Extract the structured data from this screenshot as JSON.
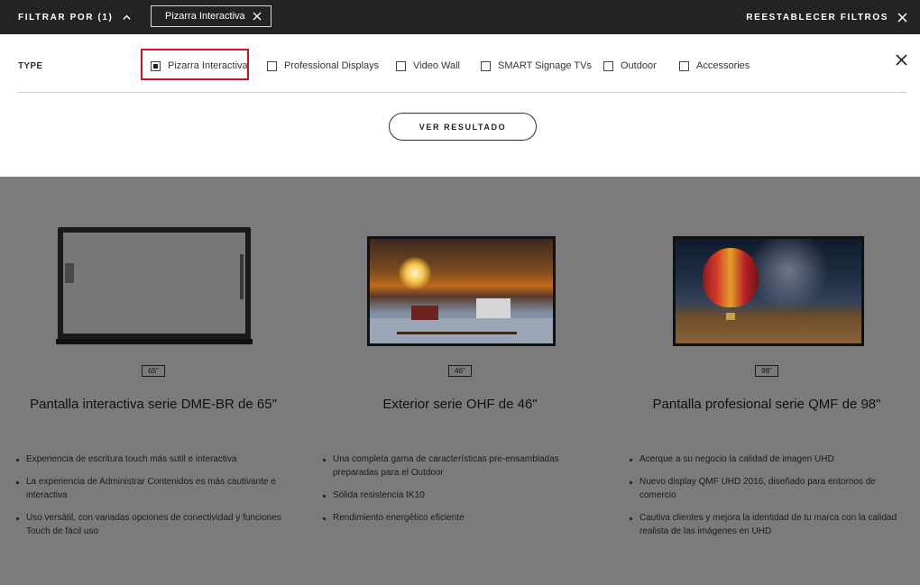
{
  "topbar": {
    "filter_toggle_label": "FILTRAR POR (1)",
    "active_chip_label": "Pizarra Interactiva",
    "reset_label": "REESTABLECER FILTROS"
  },
  "filter_panel": {
    "type_label": "TYPE",
    "options": [
      {
        "label": "Pizarra Interactiva",
        "checked": true
      },
      {
        "label": "Professional Displays",
        "checked": false
      },
      {
        "label": "Video Wall",
        "checked": false
      },
      {
        "label": "SMART Signage TVs",
        "checked": false
      },
      {
        "label": "Outdoor",
        "checked": false
      },
      {
        "label": "Accessories",
        "checked": false
      }
    ],
    "results_button_label": "VER RESULTADO"
  },
  "products": [
    {
      "size": "65\"",
      "name": "Pantalla interactiva serie DME-BR de 65\"",
      "features": [
        "Experiencia de escritura touch más sutil e interactiva",
        "La experiencia de Administrar Contenidos es más cautivante e interactiva",
        "Uso versátil, con variadas opciones de conectividad y funciones Touch de fácil uso"
      ]
    },
    {
      "size": "46\"",
      "name": "Exterior serie OHF de 46\"",
      "features": [
        "Una completa gama de características pre-ensambladas preparadas para el Outdoor",
        "Sólida resistencia IK10",
        "Rendimiento energético eficiente"
      ]
    },
    {
      "size": "98\"",
      "name": "Pantalla profesional serie QMF de 98\"",
      "features": [
        "Acerque a su negocio la calidad de imagen UHD",
        "Nuevo display QMF UHD 2016, diseñado para entornos de comercio",
        "Cautiva clientes y mejora la identidad de tu marca con la calidad realista de las imágenes en UHD"
      ]
    }
  ],
  "colors": {
    "topbar_bg": "#232323",
    "overlay_bg": "#7b7b7b",
    "highlight": "#d0121b"
  }
}
